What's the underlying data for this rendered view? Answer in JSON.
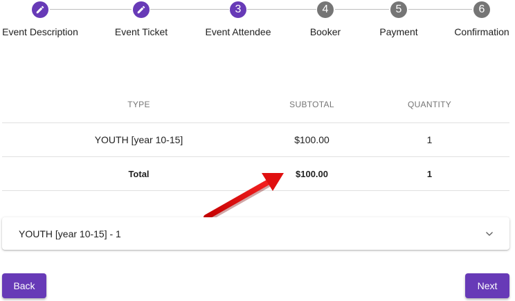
{
  "stepper": {
    "steps": [
      {
        "number": "",
        "label": "Event Description",
        "state": "completed",
        "icon": "pencil-icon"
      },
      {
        "number": "",
        "label": "Event Ticket",
        "state": "completed",
        "icon": "pencil-icon"
      },
      {
        "number": "3",
        "label": "Event Attendee",
        "state": "active"
      },
      {
        "number": "4",
        "label": "Booker",
        "state": "inactive"
      },
      {
        "number": "5",
        "label": "Payment",
        "state": "inactive"
      },
      {
        "number": "6",
        "label": "Confirmation",
        "state": "inactive"
      }
    ],
    "colors": {
      "active": "#673ab7",
      "inactive": "#757575"
    }
  },
  "table": {
    "headers": {
      "type": "TYPE",
      "subtotal": "SUBTOTAL",
      "quantity": "QUANTITY"
    },
    "rows": [
      {
        "type": "YOUTH [year 10-15]",
        "subtotal": "$100.00",
        "quantity": "1"
      }
    ],
    "total": {
      "label": "Total",
      "subtotal": "$100.00",
      "quantity": "1"
    }
  },
  "annotation": {
    "icon": "red-arrow-icon",
    "color": "#e01010"
  },
  "accordion": {
    "title": "YOUTH [year 10-15] - 1",
    "icon": "chevron-down-icon"
  },
  "buttons": {
    "back": "Back",
    "next": "Next",
    "color": "#673ab7"
  }
}
